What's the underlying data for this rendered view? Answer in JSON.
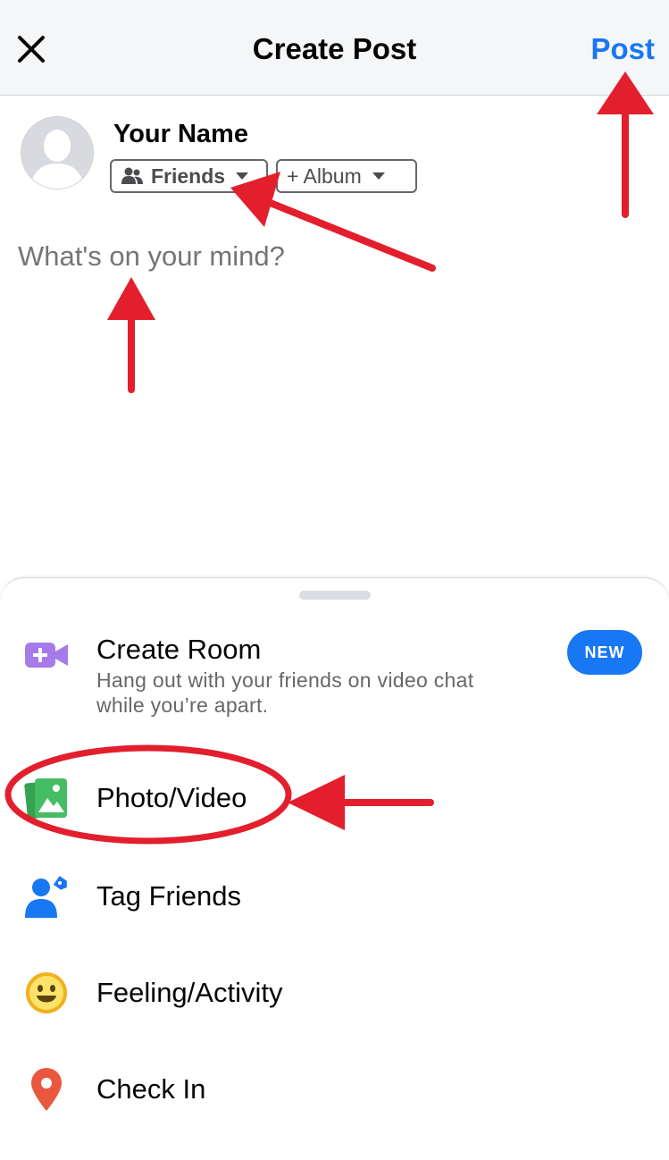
{
  "header": {
    "title": "Create Post",
    "post_label": "Post",
    "close_icon": "close-icon"
  },
  "user": {
    "name": "Your Name",
    "audience_label": "Friends",
    "audience_icon": "friends-icon",
    "album_label": "+ Album"
  },
  "composer": {
    "placeholder": "What's on your mind?"
  },
  "sheet": {
    "options": [
      {
        "label": "Create Room",
        "subtitle": "Hang out with your friends on video chat while you’re apart.",
        "badge": "NEW",
        "icon": "video-camera-plus-icon",
        "color": "#a779e9"
      },
      {
        "label": "Photo/Video",
        "icon": "photo-icon",
        "color": "#45bd62"
      },
      {
        "label": "Tag Friends",
        "icon": "tag-friends-icon",
        "color": "#1877f2"
      },
      {
        "label": "Feeling/Activity",
        "icon": "smiley-icon",
        "color": "#f7b928"
      },
      {
        "label": "Check In",
        "icon": "location-pin-icon",
        "color": "#e9573f"
      }
    ]
  },
  "colors": {
    "accent": "#1877f2",
    "annotation": "#e31e2d"
  }
}
